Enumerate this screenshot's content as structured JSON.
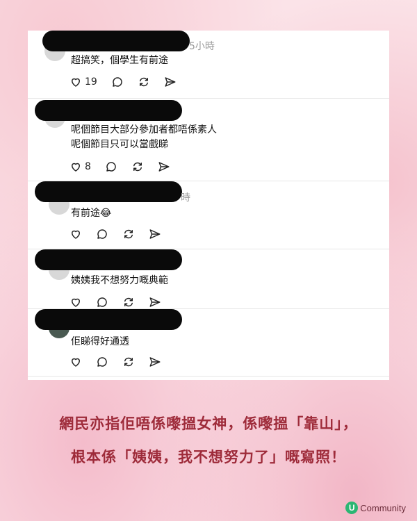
{
  "comments": [
    {
      "time": "5小時",
      "lines": [
        "超搞笑，個學生有前途"
      ],
      "likes": "19"
    },
    {
      "time": "",
      "lines": [
        "呢個節目大部分參加者都唔係素人",
        "呢個節目只可以當戲睇"
      ],
      "likes": "8"
    },
    {
      "time": "時",
      "lines": [
        "有前途😂"
      ],
      "likes": ""
    },
    {
      "time": "",
      "lines": [
        "姨姨我不想努力嘅典範"
      ],
      "likes": ""
    },
    {
      "time": "",
      "lines": [
        "佢睇得好通透"
      ],
      "likes": ""
    }
  ],
  "caption": {
    "line1": "網民亦指佢唔係嚟搵女神，係嚟搵「靠山」，",
    "line2": "根本係「姨姨，我不想努力了」嘅寫照！"
  },
  "brand": {
    "logo": "U",
    "name": "Community"
  },
  "icons": [
    "heart-icon",
    "comment-icon",
    "repost-icon",
    "share-icon"
  ],
  "colors": {
    "caption": "#9e2b3a",
    "brand_green": "#2bb673"
  }
}
